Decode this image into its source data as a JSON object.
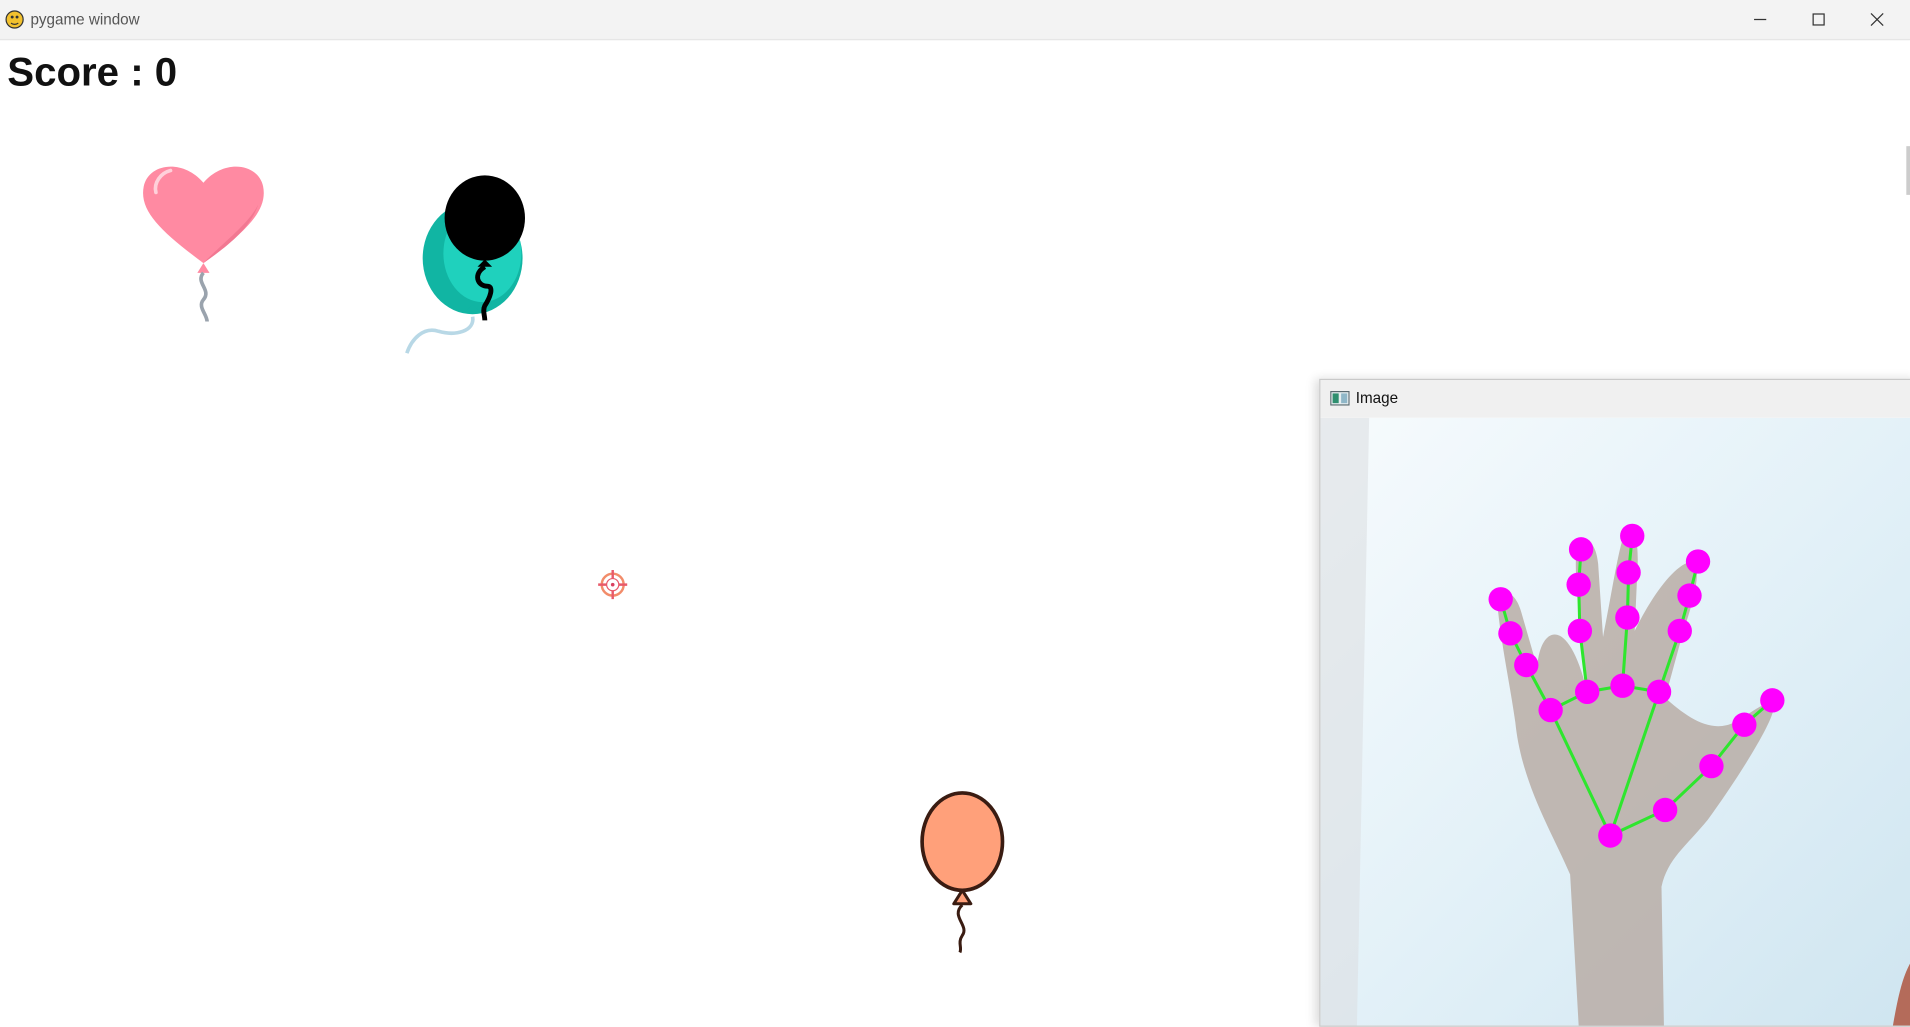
{
  "pygame_window": {
    "title": "pygame window",
    "controls": [
      "minimize-icon",
      "maximize-icon",
      "close-icon"
    ],
    "score_text": "Score : 0"
  },
  "balloons": [
    {
      "kind": "heart",
      "color": "#ff8aa2"
    },
    {
      "kind": "round",
      "color": "#17c2b0"
    },
    {
      "kind": "round",
      "color": "#000000"
    },
    {
      "kind": "round",
      "color": "#ffa07a"
    }
  ],
  "crosshair": {
    "icon": "crosshair-icon",
    "color": "#e85a6a"
  },
  "image_window": {
    "title": "Image",
    "landmark_color": "#ff00ff",
    "connection_color": "#2ee62e"
  }
}
